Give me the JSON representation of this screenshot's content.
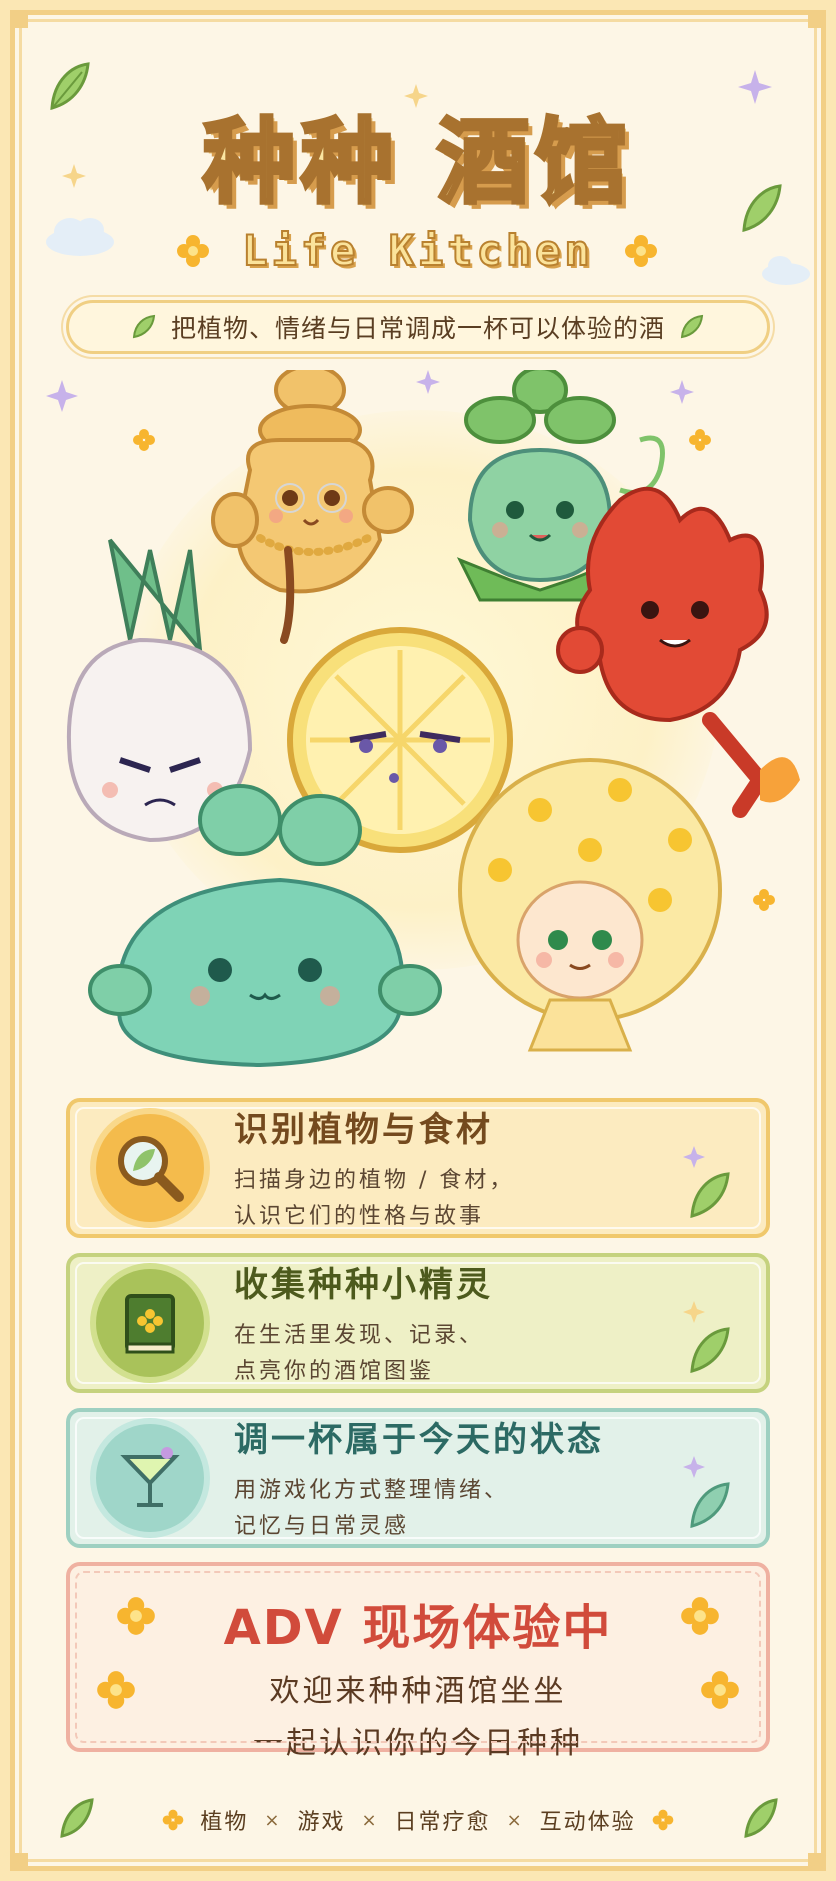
{
  "title": "种种 酒馆",
  "subtitle": "Life Kitchen",
  "tagline": "把植物、情绪与日常调成一杯可以体验的酒",
  "features": [
    {
      "title": "识别植物与食材",
      "line1": "扫描身边的植物 / 食材，",
      "line2": "认识它们的性格与故事",
      "icon": "magnifier-leaf-icon"
    },
    {
      "title": "收集种种小精灵",
      "line1": "在生活里发现、记录、",
      "line2": "点亮你的酒馆图鉴",
      "icon": "book-icon"
    },
    {
      "title": "调一杯属于今天的状态",
      "line1": "用游戏化方式整理情绪、",
      "line2": "记忆与日常灵感",
      "icon": "cocktail-icon"
    }
  ],
  "event": {
    "title": "ADV 现场体验中",
    "line1": "欢迎来种种酒馆坐坐",
    "line2": "一起认识你的今日种种"
  },
  "footer": {
    "items": [
      "植物",
      "游戏",
      "日常疗愈",
      "互动体验"
    ],
    "separator": "×"
  },
  "characters": [
    "ginger-granny-character",
    "clover-sprout-character",
    "scallion-character",
    "lemon-character",
    "chili-flame-character",
    "mint-slime-character",
    "osmanthus-girl-character"
  ],
  "colors": {
    "frame": "#f2cf86",
    "background": "#fdf6e6",
    "accent_red": "#d14b3b"
  }
}
